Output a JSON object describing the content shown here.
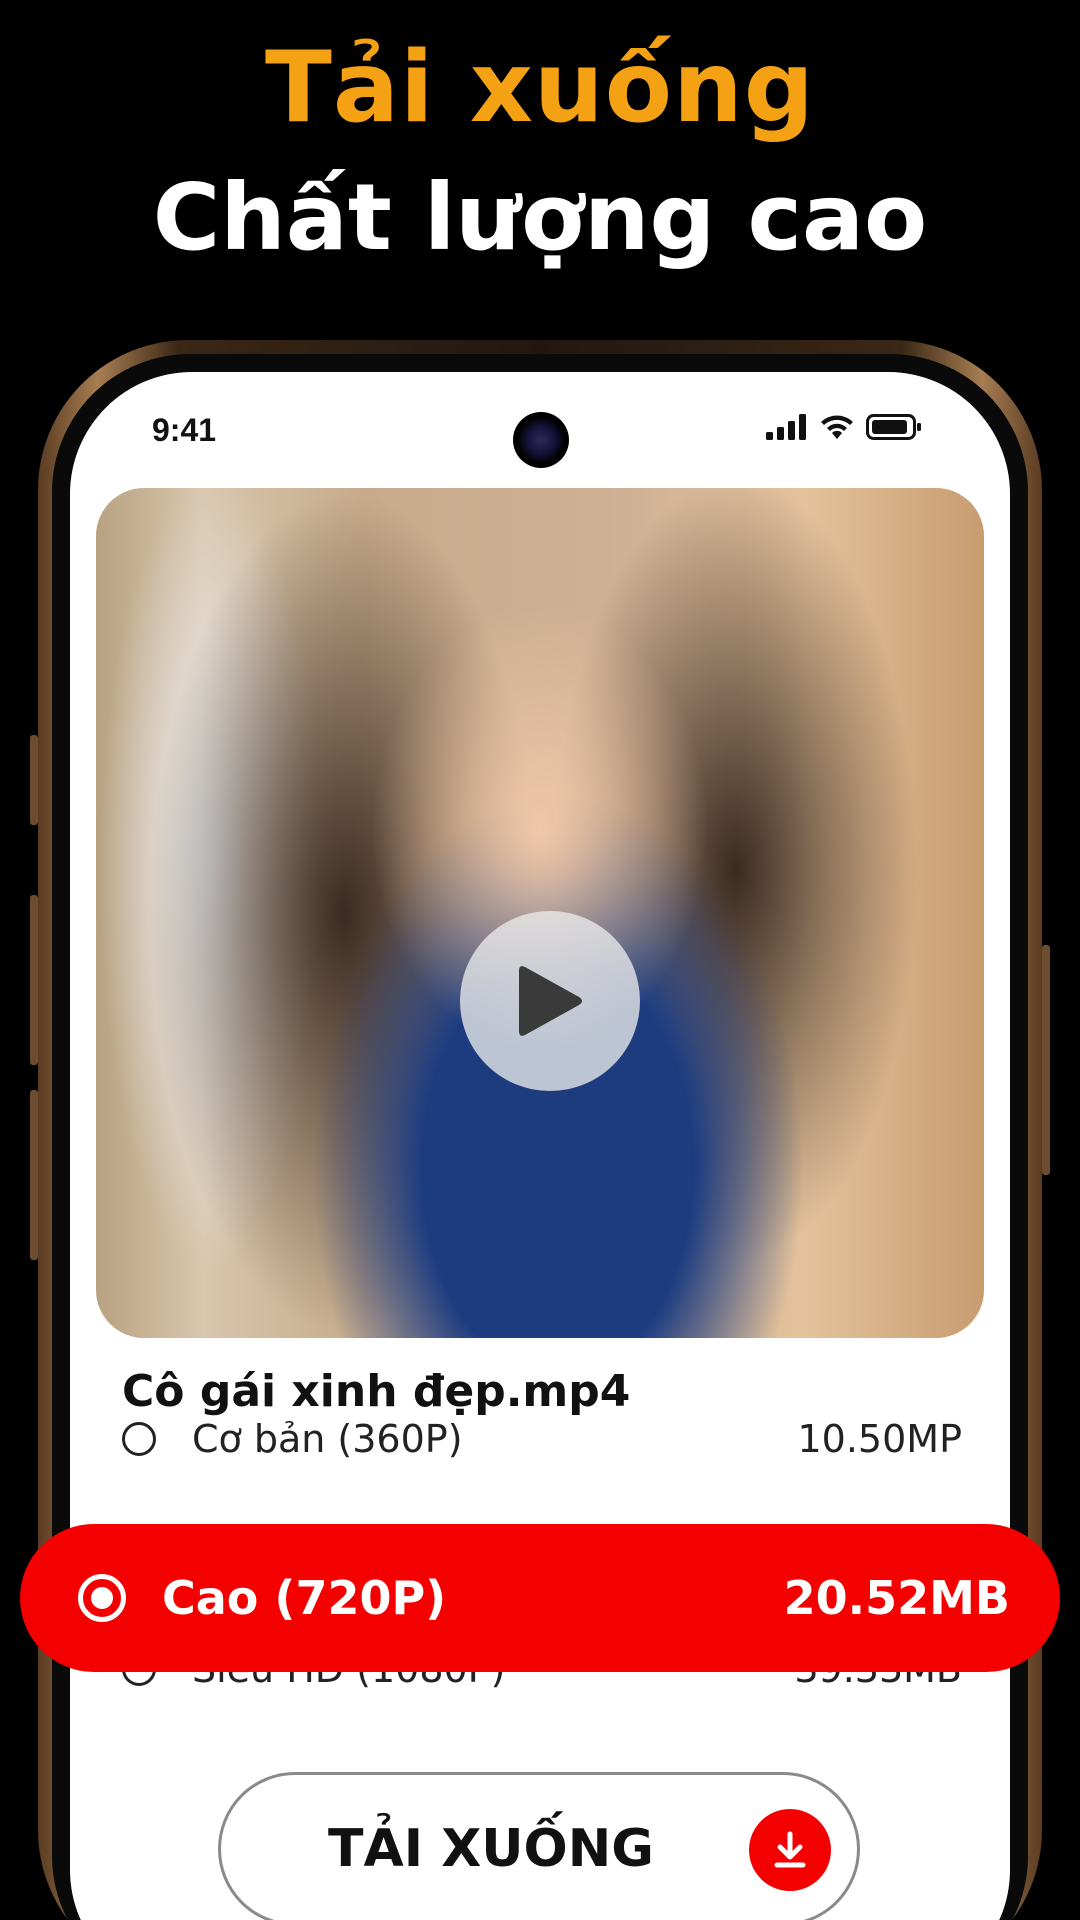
{
  "headline": {
    "line1": "Tải xuống",
    "line2": "Chất lượng cao"
  },
  "status_bar": {
    "time": "9:41",
    "icons": [
      "cellular-signal-icon",
      "wifi-icon",
      "battery-icon"
    ]
  },
  "video": {
    "file_name": "Cô gái xinh đẹp.mp4",
    "play_icon": "play-icon"
  },
  "quality_options": [
    {
      "label": "Cơ bản (360P)",
      "size": "10.50MP",
      "selected": false
    },
    {
      "label": "Cao (720P)",
      "size": "20.52MB",
      "selected": true
    },
    {
      "label": "Siêu HD (1080P)",
      "size": "39.33MB",
      "selected": false
    }
  ],
  "download": {
    "label": "TẢI XUỐNG",
    "icon": "download-icon"
  },
  "colors": {
    "accent_red": "#f40000",
    "headline_orange": "#f5a114",
    "background": "#000000"
  }
}
